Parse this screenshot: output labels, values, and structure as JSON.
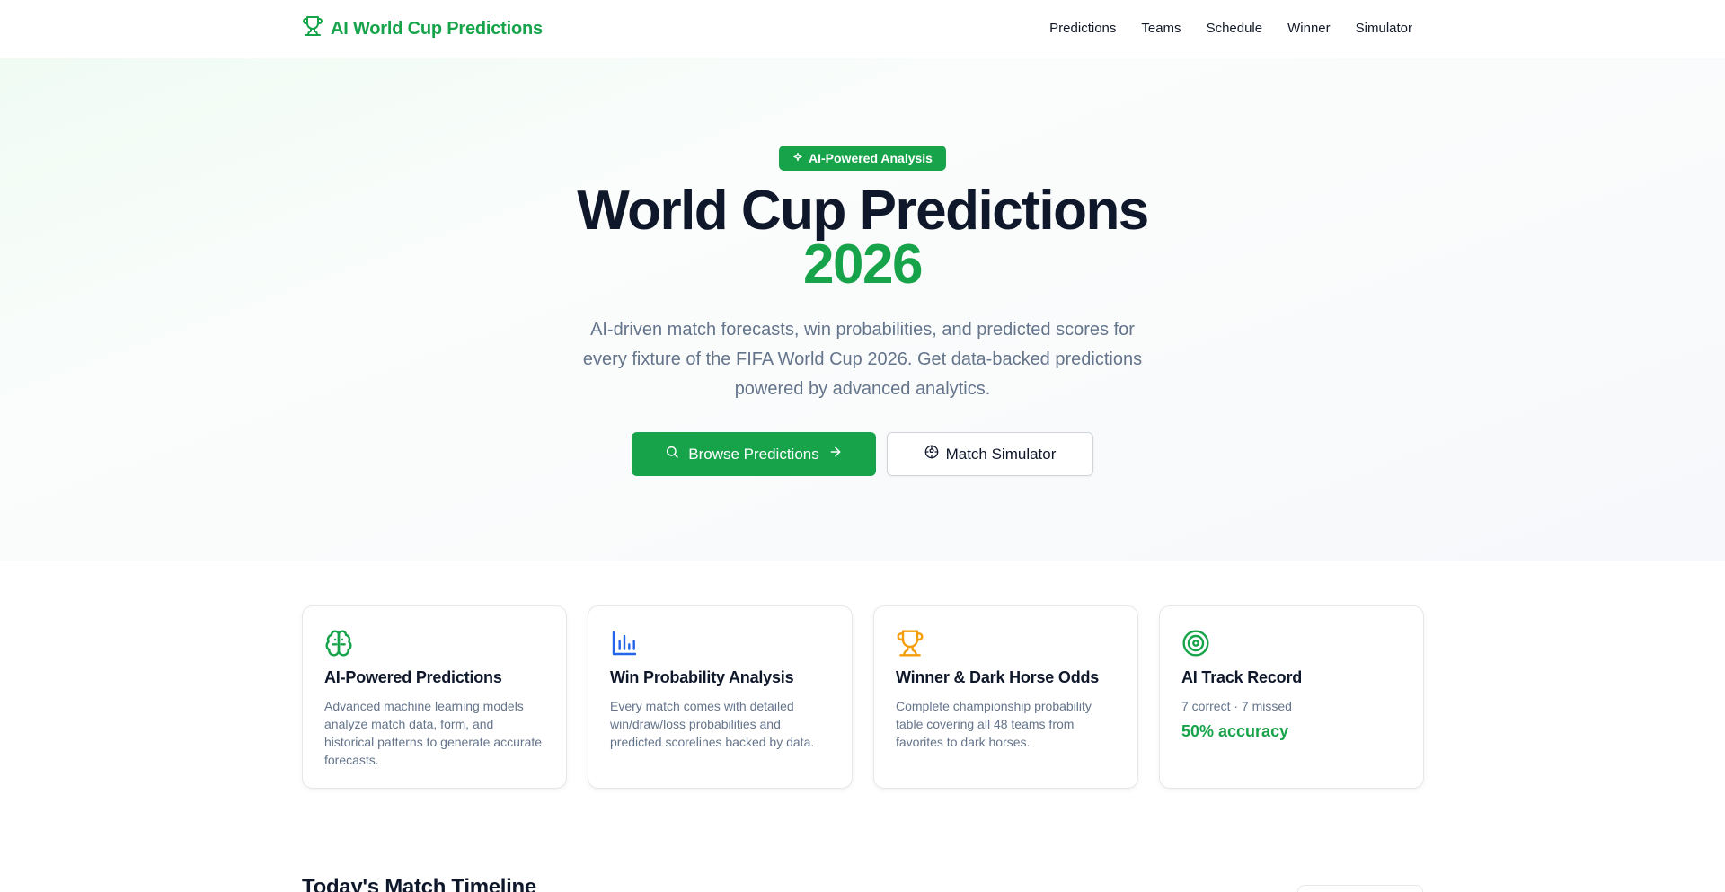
{
  "header": {
    "brand": "AI World Cup Predictions",
    "nav": [
      "Predictions",
      "Teams",
      "Schedule",
      "Winner",
      "Simulator"
    ]
  },
  "hero": {
    "badge": "AI-Powered Analysis",
    "title_line1": "World Cup Predictions",
    "title_line2": "2026",
    "subtitle": "AI-driven match forecasts, win probabilities, and predicted scores for every fixture of the FIFA World Cup 2026. Get data-backed predictions powered by advanced analytics.",
    "primary_button": "Browse Predictions",
    "secondary_button": "Match Simulator"
  },
  "features": [
    {
      "icon": "brain-icon",
      "color": "#16a34a",
      "title": "AI-Powered Predictions",
      "text": "Advanced machine learning models analyze match data, form, and historical patterns to generate accurate forecasts."
    },
    {
      "icon": "bar-chart-icon",
      "color": "#2563eb",
      "title": "Win Probability Analysis",
      "text": "Every match comes with detailed win/draw/loss probabilities and predicted scorelines backed by data."
    },
    {
      "icon": "trophy-icon",
      "color": "#f59e0b",
      "title": "Winner & Dark Horse Odds",
      "text": "Complete championship probability table covering all 48 teams from favorites to dark horses."
    },
    {
      "icon": "target-icon",
      "color": "#16a34a",
      "title": "AI Track Record",
      "text": "7 correct · 7 missed",
      "accuracy": "50% accuracy"
    }
  ],
  "timeline": {
    "title": "Today's Match Timeline"
  },
  "colors": {
    "accent": "#16a34a",
    "text": "#0f172a",
    "muted": "#64748b"
  }
}
